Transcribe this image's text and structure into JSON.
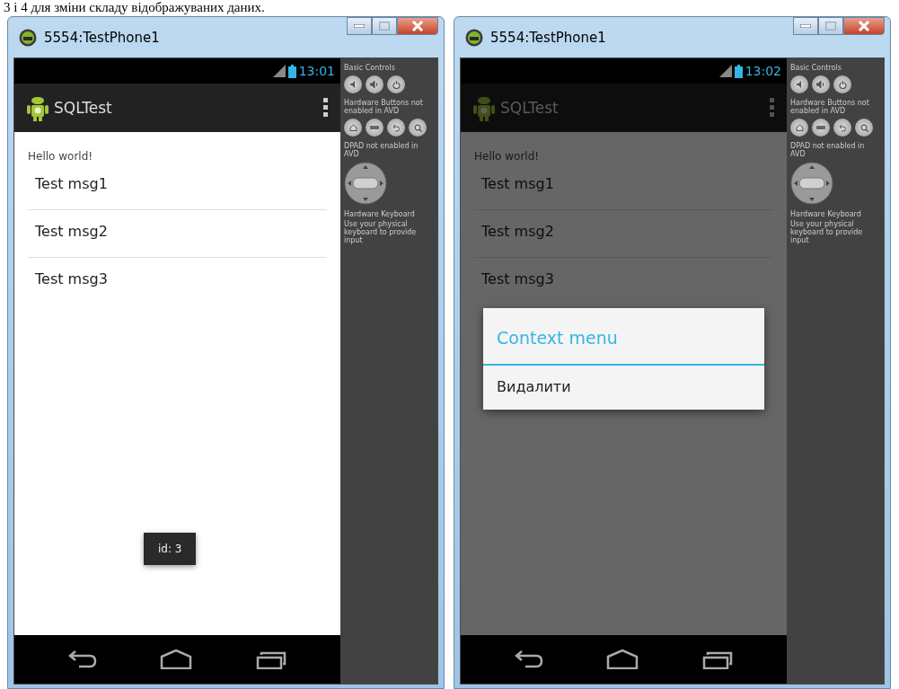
{
  "caption": "3 і 4 для зміни складу відображуваних даних.",
  "windows": [
    {
      "title": "5554:TestPhone1",
      "time": "13:01",
      "app_title": "SQLTest",
      "content_label": "Hello world!",
      "dimmed": false,
      "items": [
        {
          "text": "Test msg1"
        },
        {
          "text": "Test msg2"
        },
        {
          "text": "Test msg3"
        }
      ],
      "toast": "id: 3",
      "panel": {
        "basic": "Basic Controls",
        "hardware": "Hardware Buttons not enabled in AVD",
        "dpad": "DPAD not enabled in AVD",
        "keyboard": "Hardware Keyboard",
        "keyboard_hint": "Use your physical keyboard to provide input"
      }
    },
    {
      "title": "5554:TestPhone1",
      "time": "13:02",
      "app_title": "SQLTest",
      "content_label": "Hello world!",
      "dimmed": true,
      "items": [
        {
          "text": "Test msg1"
        },
        {
          "text": "Test msg2"
        },
        {
          "text": "Test msg3"
        }
      ],
      "dialog": {
        "title": "Context menu",
        "items": [
          "Видалити"
        ]
      },
      "panel": {
        "basic": "Basic Controls",
        "hardware": "Hardware Buttons not enabled in AVD",
        "dpad": "DPAD not enabled in AVD",
        "keyboard": "Hardware Keyboard",
        "keyboard_hint": "Use your physical keyboard to provide input"
      }
    }
  ]
}
